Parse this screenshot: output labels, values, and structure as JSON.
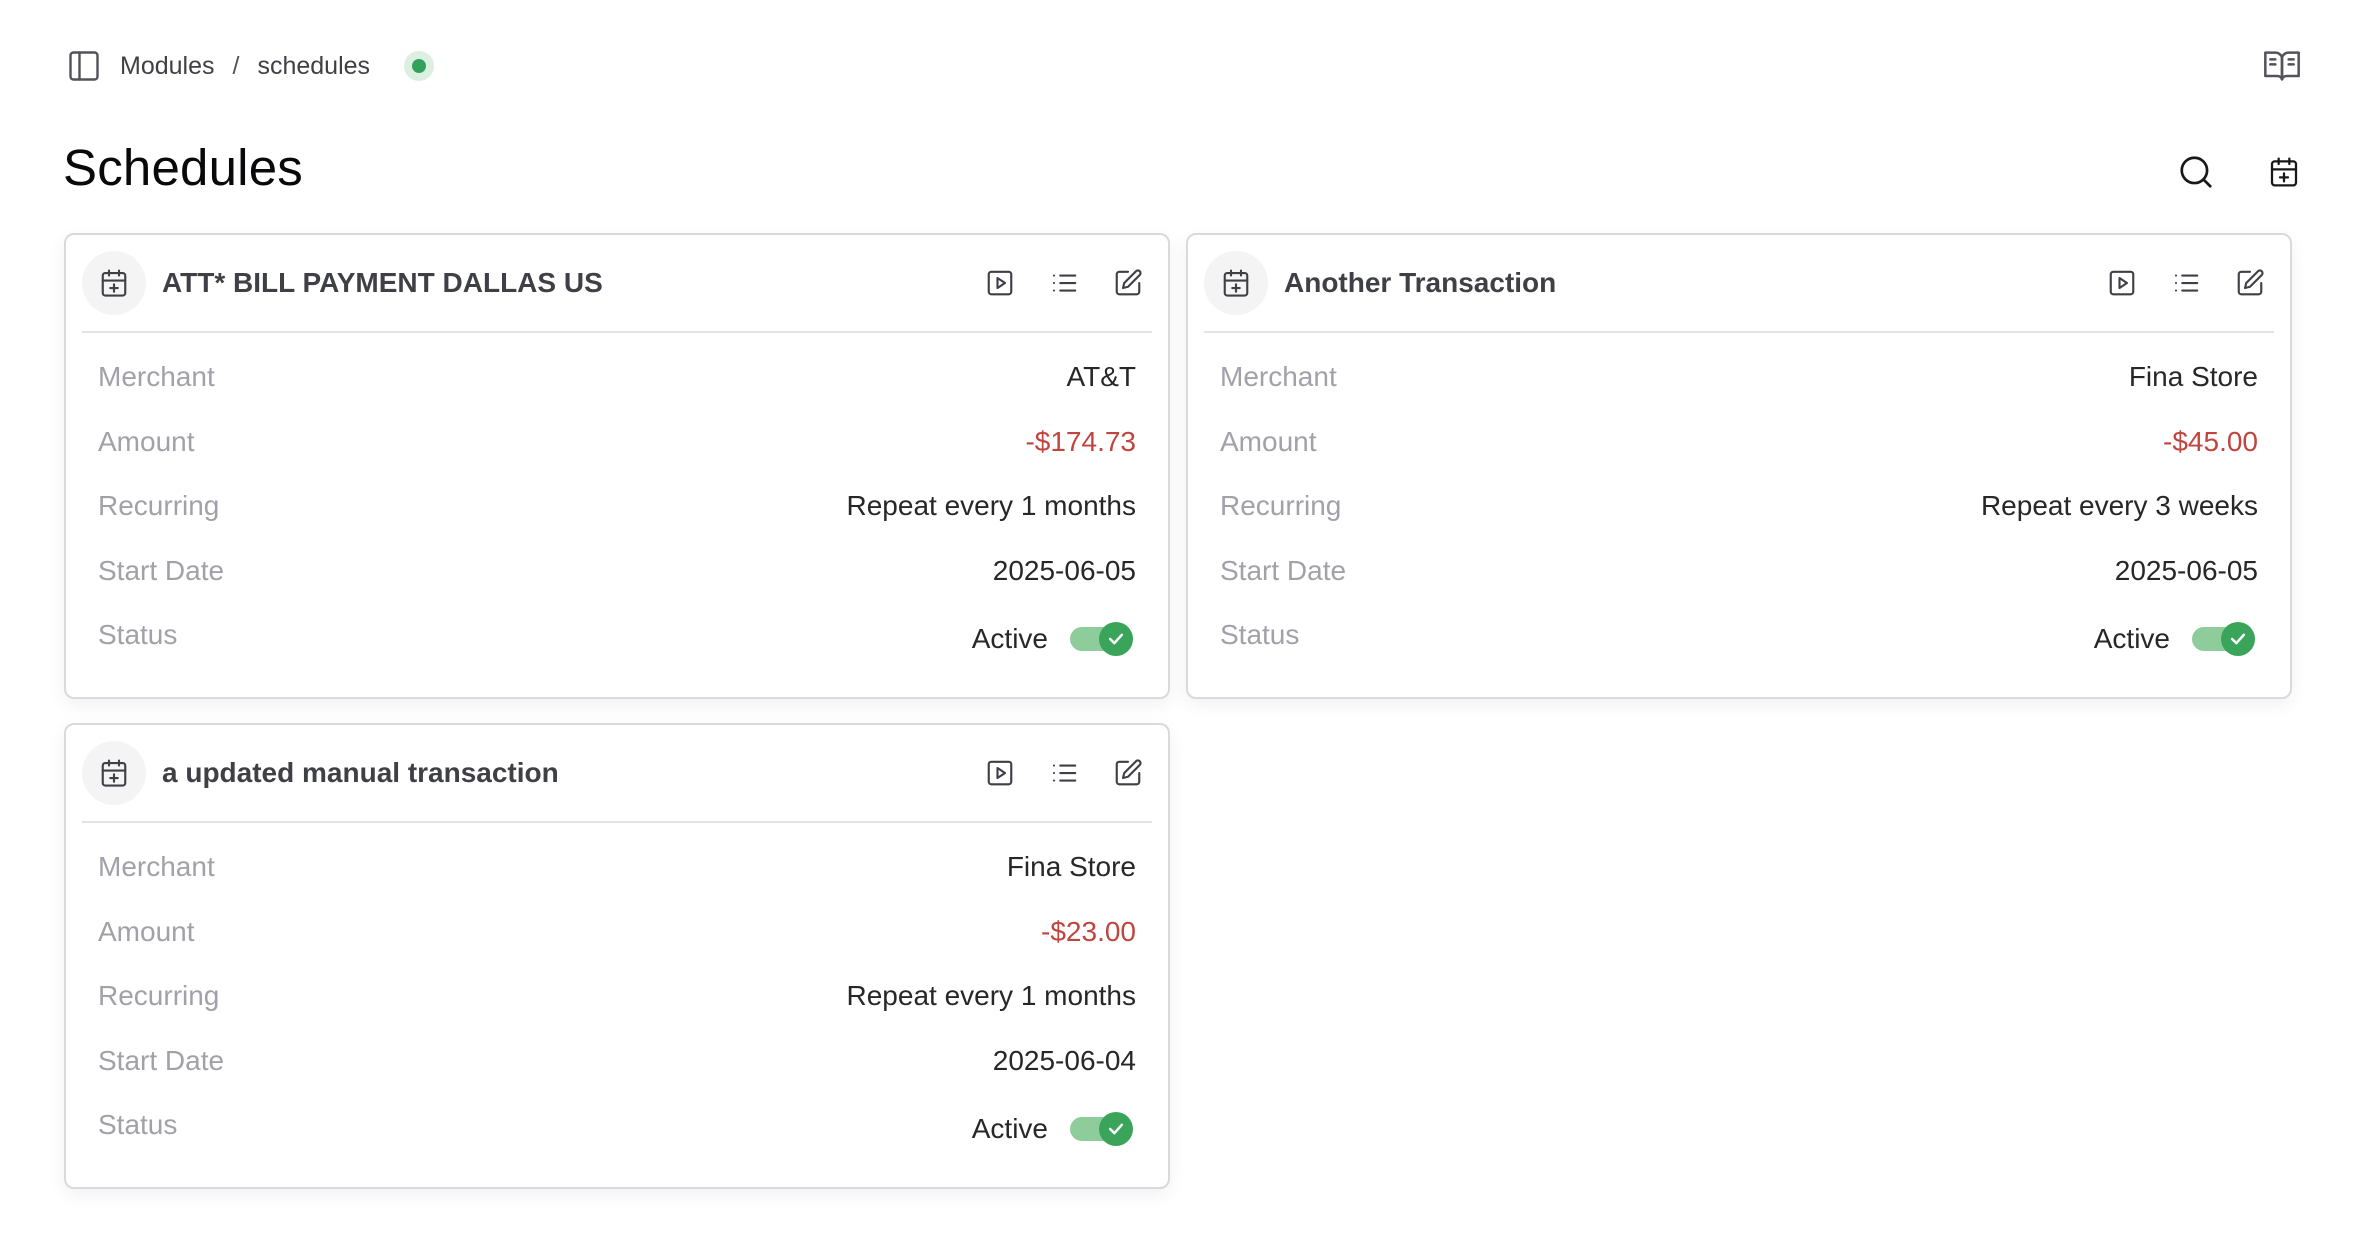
{
  "breadcrumb": {
    "root": "Modules",
    "separator": "/",
    "current": "schedules"
  },
  "page": {
    "title": "Schedules"
  },
  "icons": {
    "sidebar": "sidebar-toggle-icon",
    "docs": "book-open-icon",
    "search": "search-icon",
    "add_schedule": "calendar-plus-icon",
    "card_avatar": "calendar-plus-icon",
    "run": "play-square-icon",
    "list": "list-icon",
    "edit": "edit-icon"
  },
  "colors": {
    "accent_green": "#3aa55a",
    "negative": "#c0453f",
    "muted": "#a1a1aa"
  },
  "labels": {
    "merchant": "Merchant",
    "amount": "Amount",
    "recurring": "Recurring",
    "start_date": "Start Date",
    "status": "Status"
  },
  "schedules": [
    {
      "title": "ATT* BILL PAYMENT DALLAS US",
      "merchant": "AT&T",
      "amount": "-$174.73",
      "recurring": "Repeat every 1 months",
      "start_date": "2025-06-05",
      "status": "Active",
      "active": true
    },
    {
      "title": "Another Transaction",
      "merchant": "Fina Store",
      "amount": "-$45.00",
      "recurring": "Repeat every 3 weeks",
      "start_date": "2025-06-05",
      "status": "Active",
      "active": true
    },
    {
      "title": "a updated manual transaction",
      "merchant": "Fina Store",
      "amount": "-$23.00",
      "recurring": "Repeat every 1 months",
      "start_date": "2025-06-04",
      "status": "Active",
      "active": true
    }
  ]
}
